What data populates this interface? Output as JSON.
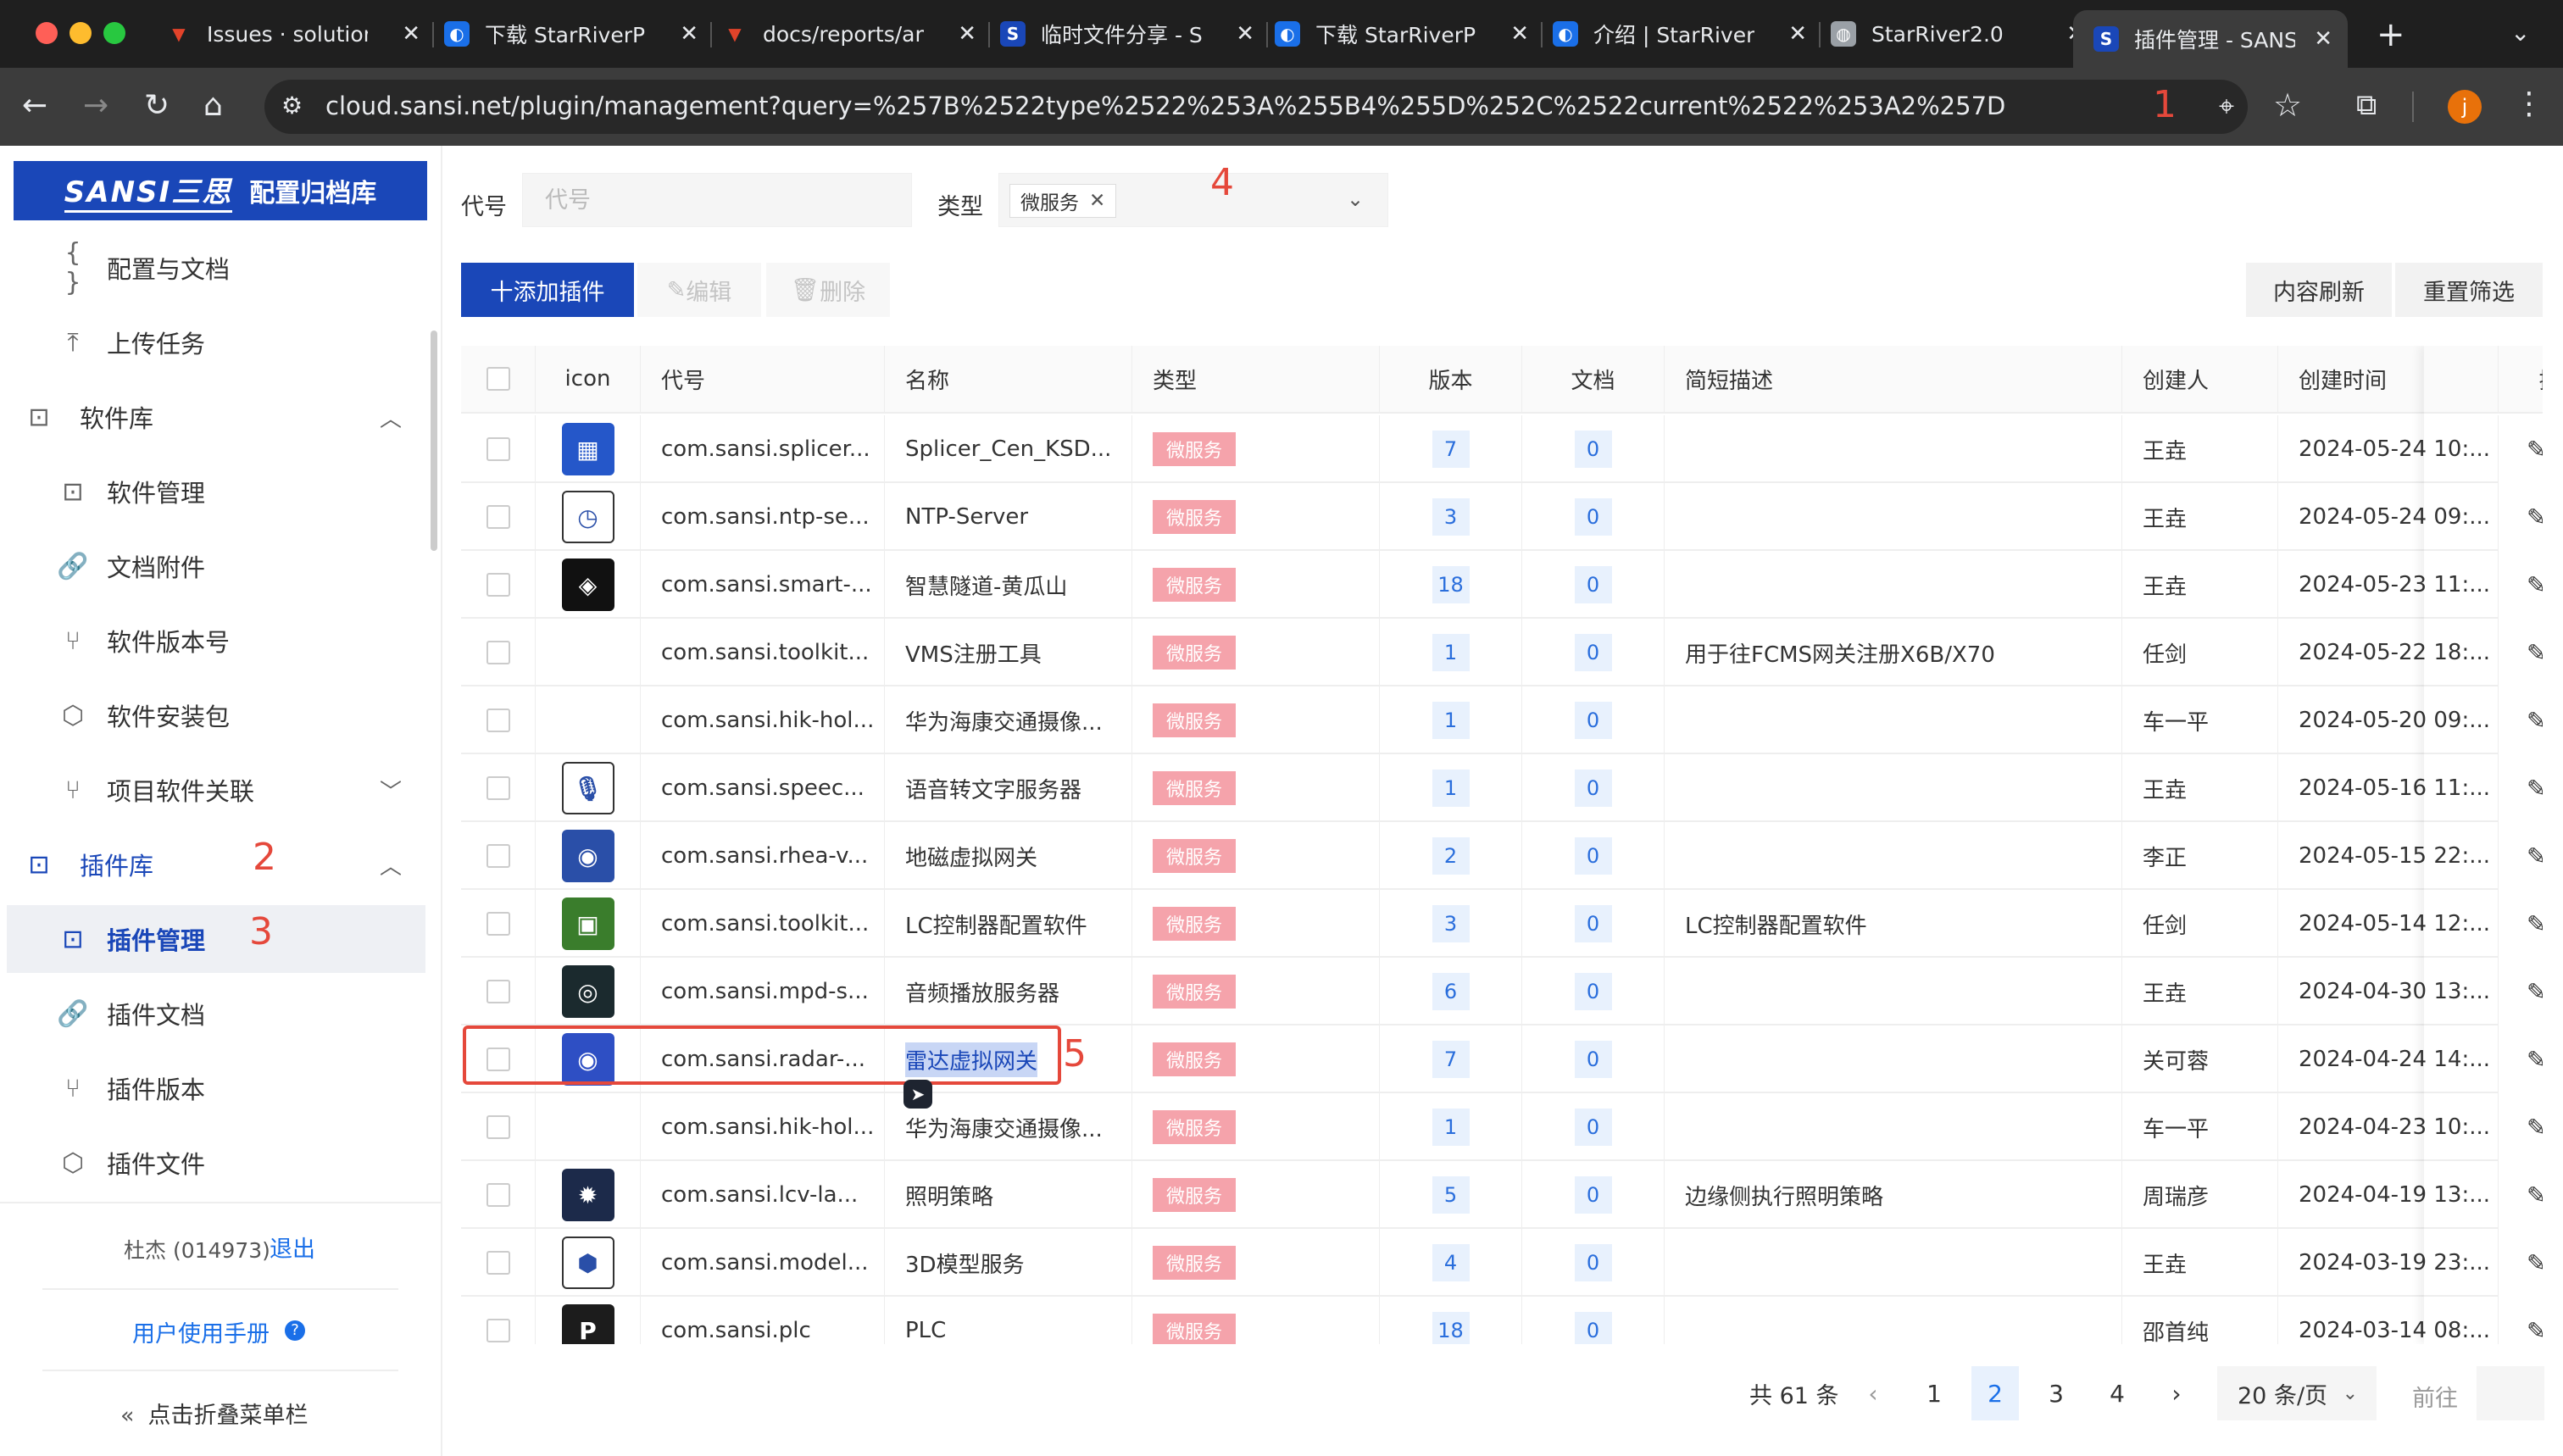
{
  "browser": {
    "tabs": [
      {
        "title": "Issues · solution",
        "icon": "gitlab-fox-icon",
        "color": "#e2432a"
      },
      {
        "title": "下载 StarRiverPr",
        "icon": "starriver-icon",
        "color": "#1a6fe8"
      },
      {
        "title": "docs/reports/an",
        "icon": "gitlab-fox-icon",
        "color": "#e2432a"
      },
      {
        "title": "临时文件分享 - S",
        "icon": "sansi-s-icon",
        "color": "#1a47b8"
      },
      {
        "title": "下载 StarRiverPr",
        "icon": "starriver-icon",
        "color": "#1a6fe8"
      },
      {
        "title": "介绍 | StarRiverP",
        "icon": "starriver-icon",
        "color": "#1a6fe8"
      },
      {
        "title": "StarRiver2.0",
        "icon": "globe-icon",
        "color": "#9aa0a6"
      },
      {
        "title": "插件管理 - SANS",
        "icon": "sansi-s-icon",
        "color": "#1a47b8",
        "active": true
      }
    ],
    "url": "cloud.sansi.net/plugin/management?query=%257B%2522type%2522%253A%255B4%255D%252C%2522current%2522%253A2%257D",
    "profile_initial": "j",
    "annotation": "1"
  },
  "sidebar": {
    "brand_logo": "SANSI三思",
    "brand_title": "配置归档库",
    "items": [
      {
        "label": "配置与文档",
        "icon": "braces-icon",
        "kind": "sub"
      },
      {
        "label": "上传任务",
        "icon": "upload-icon",
        "kind": "sub"
      },
      {
        "label": "软件库",
        "icon": "code-file-icon",
        "kind": "group",
        "chevron": "up"
      },
      {
        "label": "软件管理",
        "icon": "code-file-icon",
        "kind": "sub"
      },
      {
        "label": "文档附件",
        "icon": "link-icon",
        "kind": "sub"
      },
      {
        "label": "软件版本号",
        "icon": "branch-icon",
        "kind": "sub"
      },
      {
        "label": "软件安装包",
        "icon": "package-icon",
        "kind": "sub"
      },
      {
        "label": "项目软件关联",
        "icon": "branch-icon",
        "kind": "sub",
        "chevron": "down"
      },
      {
        "label": "插件库",
        "icon": "code-file-icon",
        "kind": "group",
        "chevron": "up",
        "active_group": true
      },
      {
        "label": "插件管理",
        "icon": "code-file-icon",
        "kind": "sub",
        "selected": true
      },
      {
        "label": "插件文档",
        "icon": "link-icon",
        "kind": "sub"
      },
      {
        "label": "插件版本",
        "icon": "branch-icon",
        "kind": "sub"
      },
      {
        "label": "插件文件",
        "icon": "package-icon",
        "kind": "sub"
      }
    ],
    "annotation_group": "2",
    "annotation_selected": "3",
    "user": "杜杰 (014973)",
    "logout": "退出",
    "manual": "用户使用手册",
    "collapse": "点击折叠菜单栏"
  },
  "filters": {
    "code_label": "代号",
    "code_placeholder": "代号",
    "type_label": "类型",
    "type_tag": "微服务",
    "annotation": "4"
  },
  "toolbar": {
    "add": "十添加插件",
    "edit": "编辑",
    "delete": "删除",
    "refresh": "内容刷新",
    "reset": "重置筛选"
  },
  "table": {
    "headers": [
      "icon",
      "代号",
      "名称",
      "类型",
      "版本",
      "文档",
      "简短描述",
      "创建人",
      "创建时间",
      "操作"
    ],
    "rows": [
      {
        "icon": "splicer-app-icon",
        "icon_color": "#2557c9",
        "code": "com.sansi.splicer...",
        "name": "Splicer_Cen_KSD...",
        "type": "微服务",
        "version": "7",
        "docs": "0",
        "desc": "",
        "creator": "王垚",
        "created": "2024-05-24 10:..."
      },
      {
        "icon": "ntp-clock-icon",
        "icon_color": "#ffffff",
        "code": "com.sansi.ntp-se...",
        "name": "NTP-Server",
        "type": "微服务",
        "version": "3",
        "docs": "0",
        "desc": "",
        "creator": "王垚",
        "created": "2024-05-24 09:..."
      },
      {
        "icon": "unity-cube-icon",
        "icon_color": "#111111",
        "code": "com.sansi.smart-...",
        "name": "智慧隧道-黄瓜山",
        "type": "微服务",
        "version": "18",
        "docs": "0",
        "desc": "",
        "creator": "王垚",
        "created": "2024-05-23 11:..."
      },
      {
        "icon": "",
        "icon_color": "",
        "code": "com.sansi.toolkit...",
        "name": "VMS注册工具",
        "type": "微服务",
        "version": "1",
        "docs": "0",
        "desc": "用于往FCMS网关注册X6B/X70",
        "creator": "任剑",
        "created": "2024-05-22 18:..."
      },
      {
        "icon": "",
        "icon_color": "",
        "code": "com.sansi.hik-hol...",
        "name": "华为海康交通摄像...",
        "type": "微服务",
        "version": "1",
        "docs": "0",
        "desc": "",
        "creator": "车一平",
        "created": "2024-05-20 09:..."
      },
      {
        "icon": "microphone-icon",
        "icon_color": "#ffffff",
        "code": "com.sansi.speec...",
        "name": "语音转文字服务器",
        "type": "微服务",
        "version": "1",
        "docs": "0",
        "desc": "",
        "creator": "王垚",
        "created": "2024-05-16 11:..."
      },
      {
        "icon": "earth-globe-icon",
        "icon_color": "#2a4fa8",
        "code": "com.sansi.rhea-v...",
        "name": "地磁虚拟网关",
        "type": "微服务",
        "version": "2",
        "docs": "0",
        "desc": "",
        "creator": "李正",
        "created": "2024-05-15 22:..."
      },
      {
        "icon": "chip-board-icon",
        "icon_color": "#3a7d2c",
        "code": "com.sansi.toolkit...",
        "name": "LC控制器配置软件",
        "type": "微服务",
        "version": "3",
        "docs": "0",
        "desc": "LC控制器配置软件",
        "creator": "任剑",
        "created": "2024-05-14 12:..."
      },
      {
        "icon": "speaker-disc-icon",
        "icon_color": "#1b2a2e",
        "code": "com.sansi.mpd-s...",
        "name": "音频播放服务器",
        "type": "微服务",
        "version": "6",
        "docs": "0",
        "desc": "",
        "creator": "王垚",
        "created": "2024-04-30 13:..."
      },
      {
        "icon": "radar-waves-icon",
        "icon_color": "#2e4fc4",
        "code": "com.sansi.radar-...",
        "name": "雷达虚拟网关",
        "type": "微服务",
        "version": "7",
        "docs": "0",
        "desc": "",
        "creator": "关可蓉",
        "created": "2024-04-24 14:...",
        "highlight": true
      },
      {
        "icon": "",
        "icon_color": "",
        "code": "com.sansi.hik-hol...",
        "name": "华为海康交通摄像...",
        "type": "微服务",
        "version": "1",
        "docs": "0",
        "desc": "",
        "creator": "车一平",
        "created": "2024-04-23 10:..."
      },
      {
        "icon": "lightbulb-icon",
        "icon_color": "#1c2a4a",
        "code": "com.sansi.lcv-la...",
        "name": "照明策略",
        "type": "微服务",
        "version": "5",
        "docs": "0",
        "desc": "边缘侧执行照明策略",
        "creator": "周瑞彦",
        "created": "2024-04-19 13:..."
      },
      {
        "icon": "model-3d-icon",
        "icon_color": "#ffffff",
        "code": "com.sansi.model...",
        "name": "3D模型服务",
        "type": "微服务",
        "version": "4",
        "docs": "0",
        "desc": "",
        "creator": "王垚",
        "created": "2024-03-19 23:..."
      },
      {
        "icon": "plc-p-icon",
        "icon_color": "#1c1c1c",
        "code": "com.sansi.plc",
        "name": "PLC",
        "type": "微服务",
        "version": "18",
        "docs": "0",
        "desc": "",
        "creator": "邵首纯",
        "created": "2024-03-14 08:..."
      }
    ],
    "annotation_row": "5"
  },
  "pagination": {
    "total": "共 61 条",
    "pages": [
      "1",
      "2",
      "3",
      "4"
    ],
    "current": "2",
    "page_size": "20 条/页",
    "goto": "前往"
  }
}
